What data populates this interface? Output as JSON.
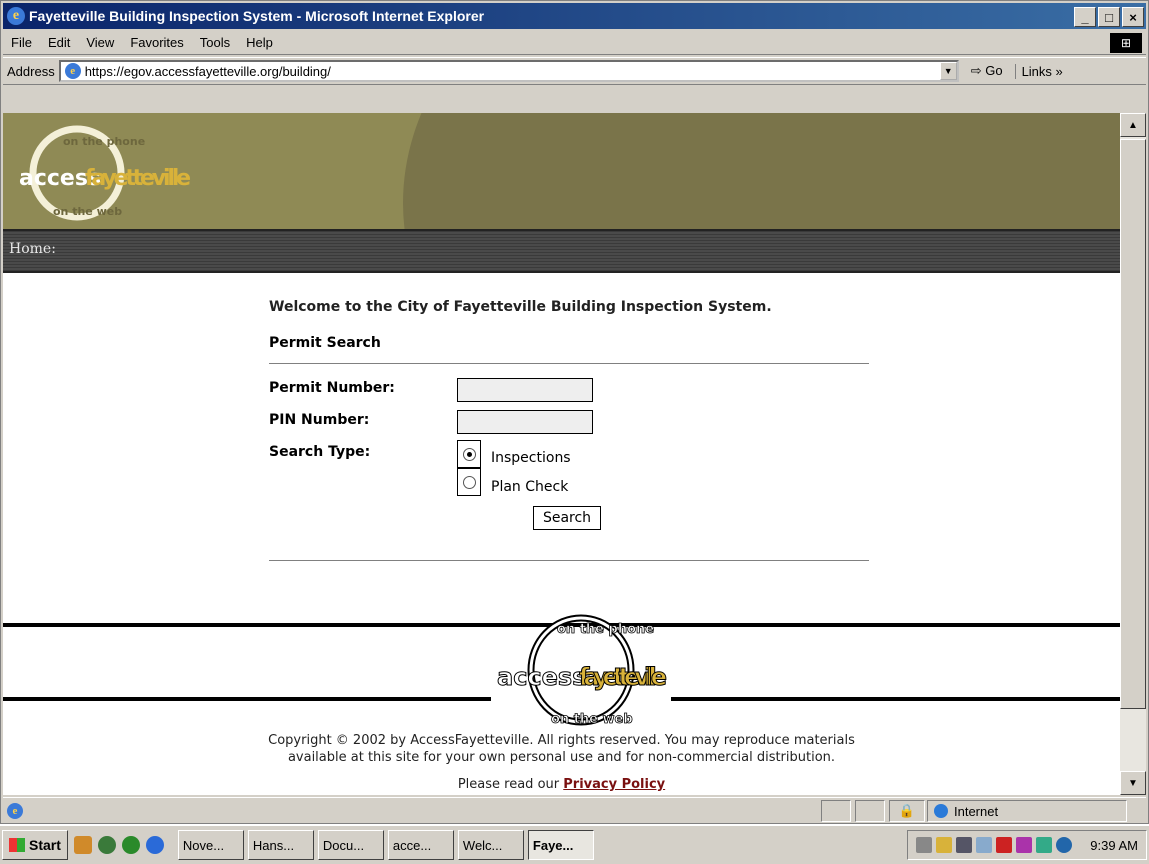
{
  "window": {
    "title": "Fayetteville Building Inspection System - Microsoft Internet Explorer"
  },
  "menu": {
    "items": [
      "File",
      "Edit",
      "View",
      "Favorites",
      "Tools",
      "Help"
    ]
  },
  "address": {
    "label": "Address",
    "url": "https://egov.accessfayetteville.org/building/",
    "go": "Go",
    "links": "Links »"
  },
  "site": {
    "logo_text_a": "access",
    "logo_text_b": "fayetteville",
    "logo_arc_top": "on the phone",
    "logo_arc_bottom": "on the web",
    "breadcrumb": "Home:"
  },
  "main": {
    "welcome": "Welcome to the City of Fayetteville Building Inspection System.",
    "section_title": "Permit Search",
    "permit_label": "Permit Number:",
    "pin_label": "PIN Number:",
    "search_type_label": "Search Type:",
    "option_inspections": "Inspections",
    "option_plan_check": "Plan Check",
    "search_button": "Search",
    "permit_value": "",
    "pin_value": ""
  },
  "footer": {
    "copyright_1": "Copyright © 2002 by AccessFayetteville. All rights reserved. You may reproduce materials",
    "copyright_2": "available at this site for your own personal use and for non-commercial distribution.",
    "privacy_prefix": "Please read our",
    "privacy_link": "Privacy Policy"
  },
  "status": {
    "zone": "Internet"
  },
  "taskbar": {
    "start": "Start",
    "tasks": [
      "Nove...",
      "Hans...",
      "Docu...",
      "acce...",
      "Welc...",
      "Faye..."
    ],
    "clock": "9:39 AM"
  },
  "colors": {
    "banner": "#8f8a55",
    "logo_yellow": "#d8b23a",
    "privacy": "#7a1010"
  }
}
